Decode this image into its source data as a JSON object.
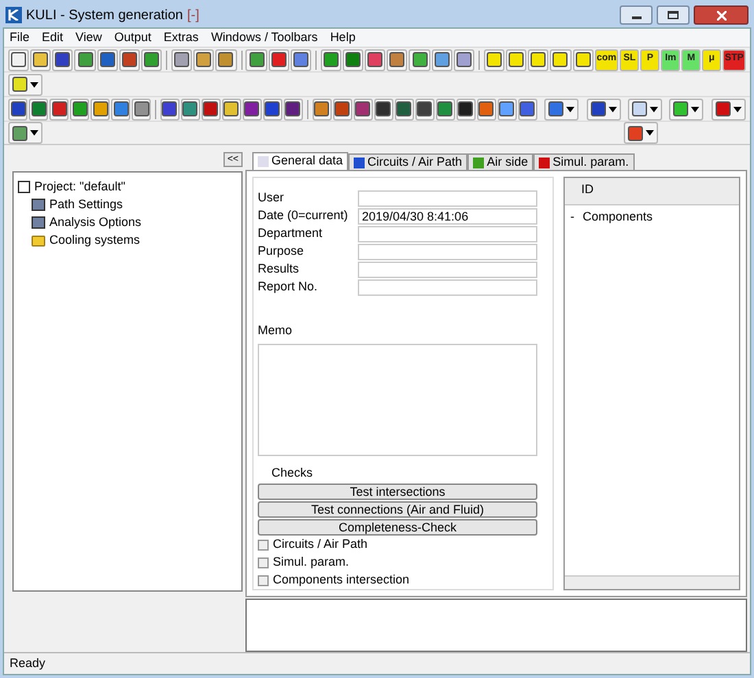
{
  "window": {
    "title": "KULI - System generation",
    "title_suffix": "[-]"
  },
  "menu": [
    "File",
    "Edit",
    "View",
    "Output",
    "Extras",
    "Windows / Toolbars",
    "Help"
  ],
  "toolbar_labels": [
    {
      "label": "com",
      "color": "#f2e400"
    },
    {
      "label": "SL",
      "color": "#f2e400"
    },
    {
      "label": "P",
      "color": "#f2e400"
    },
    {
      "label": "Im",
      "color": "#66e066"
    },
    {
      "label": "M",
      "color": "#66e066"
    },
    {
      "label": "μ",
      "color": "#f2e400"
    },
    {
      "label": "STP",
      "color": "#e02020"
    }
  ],
  "collapse_button": "<<",
  "tree": {
    "label": "Project: \"default\"",
    "children": [
      {
        "label": "Path Settings",
        "kind": "settings"
      },
      {
        "label": "Analysis Options",
        "kind": "settings"
      },
      {
        "label": "Cooling systems",
        "kind": "folder"
      }
    ]
  },
  "tabs": [
    {
      "label": "General data",
      "selected": true
    },
    {
      "label": "Circuits / Air Path",
      "selected": false
    },
    {
      "label": "Air side",
      "selected": false
    },
    {
      "label": "Simul. param.",
      "selected": false
    }
  ],
  "form": {
    "fields": [
      {
        "label": "User"
      },
      {
        "label": "Date (0=current)",
        "value": "2019/04/30 8:41:06"
      },
      {
        "label": "Department"
      },
      {
        "label": "Purpose"
      },
      {
        "label": "Results"
      },
      {
        "label": "Report No."
      }
    ],
    "memo_label": "Memo"
  },
  "checks": {
    "title": "Checks",
    "buttons": [
      "Test intersections",
      "Test connections (Air and Fluid)",
      "Completeness-Check"
    ],
    "options": [
      {
        "label": "Circuits / Air Path",
        "checked": false
      },
      {
        "label": "Simul. param.",
        "checked": false
      },
      {
        "label": "Components intersection",
        "checked": false
      }
    ]
  },
  "components": {
    "header": "ID",
    "items": [
      {
        "marker": "-",
        "label": "Components"
      }
    ]
  },
  "status_bar": "Ready"
}
